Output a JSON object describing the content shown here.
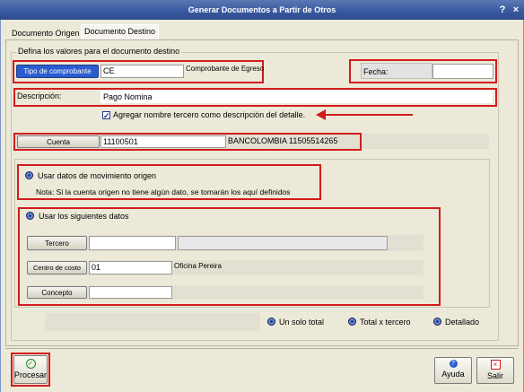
{
  "window": {
    "title": "Generar Documentos a Partir de Otros"
  },
  "tabs": [
    {
      "label": "Documento Origen"
    },
    {
      "label": "Documento Destino"
    }
  ],
  "group_defaults": {
    "legend": "Defina los valores para el documento destino"
  },
  "tipo_comprobante": {
    "button_label": "Tipo de comprobante",
    "value": "CE",
    "description": "Comprobante de Egreso"
  },
  "fecha": {
    "label": "Fecha:",
    "value": ""
  },
  "descripcion": {
    "label": "Descripción:",
    "value": "Pago Nomina"
  },
  "agregar_tercero": {
    "label": "Agregar nombre tercero como descripción del detalle.",
    "checked": true
  },
  "cuenta": {
    "button_label": "Cuenta",
    "value": "11100501",
    "description": "BANCOLOMBIA 11505514265"
  },
  "usar_origen": {
    "label": "Usar datos de movimiento origen",
    "note": "Nota: Si la cuenta origen no tiene algún dato, se tomarán los aquí definidos"
  },
  "usar_siguientes": {
    "label": "Usar los siguientes datos",
    "tercero": {
      "button_label": "Tercero",
      "value": "",
      "description": ""
    },
    "centro_costo": {
      "button_label": "Centro de costo",
      "value": "01",
      "description": "Oficina Pereira"
    },
    "concepto": {
      "button_label": "Concepto",
      "value": "",
      "description": ""
    }
  },
  "modo": {
    "options": [
      "Un solo total",
      "Total x tercero",
      "Detallado"
    ]
  },
  "buttons": {
    "procesar": "Procesar",
    "ayuda": "Ayuda",
    "salir": "Salir"
  },
  "colors": {
    "highlight_red": "#d21c1c",
    "button_blue": "#2b5ccf",
    "title_blue": "#3a5aa0"
  }
}
